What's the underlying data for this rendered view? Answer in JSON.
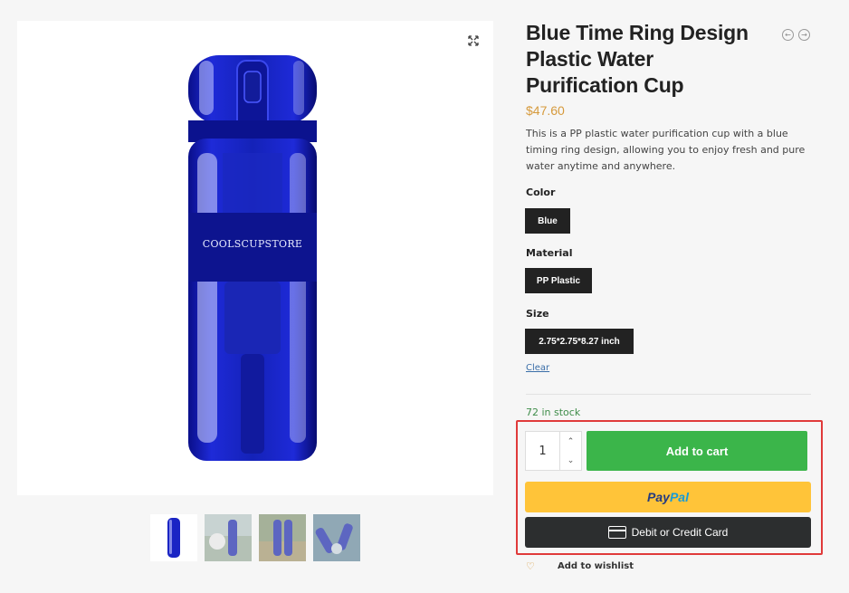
{
  "product": {
    "title": "Blue Time Ring Design Plastic Water Purification Cup",
    "price": "$47.60",
    "description": "This is a PP plastic water purification cup with a blue timing ring design, allowing you to enjoy fresh and pure water anytime and anywhere.",
    "brand_text": "COOLSCUPSTORE"
  },
  "attributes": {
    "color": {
      "label": "Color",
      "value": "Blue"
    },
    "material": {
      "label": "Material",
      "value": "PP Plastic"
    },
    "size": {
      "label": "Size",
      "value": "2.75*2.75*8.27 inch"
    },
    "clear": "Clear"
  },
  "stock": "72 in stock",
  "cart": {
    "quantity": "1",
    "add_label": "Add to cart"
  },
  "payment": {
    "paypal_part1": "Pay",
    "paypal_part2": "Pal",
    "card_label": "Debit or Credit Card"
  },
  "wishlist": "Add to wishlist",
  "icons": {
    "zoom": "expand-icon",
    "prev": "arrow-left-circle-icon",
    "next": "arrow-right-circle-icon",
    "heart": "heart-icon",
    "card": "credit-card-icon"
  },
  "colors": {
    "accent_price": "#d69a3c",
    "add_to_cart": "#3bb54a",
    "paypal": "#ffc439",
    "stock": "#3f8d4a",
    "highlight": "#e03a3a"
  }
}
